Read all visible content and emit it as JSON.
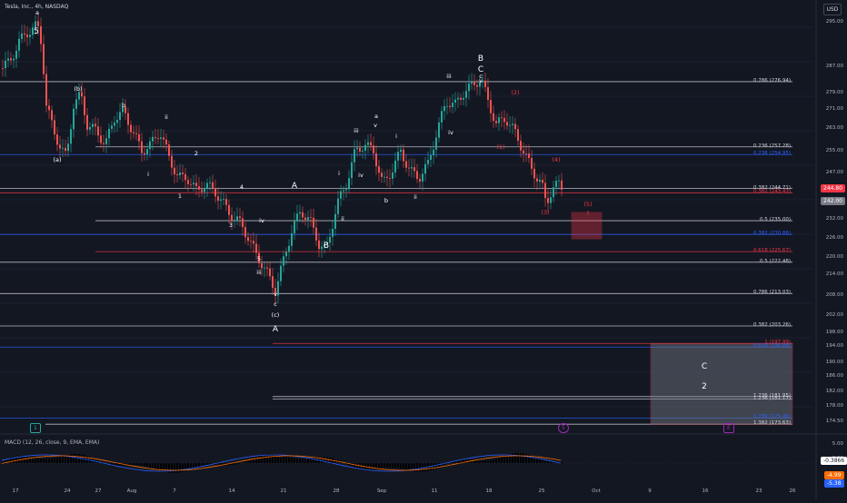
{
  "header": {
    "symbol": "Tesla, Inc., 4h, NASDAQ",
    "currency": "USD"
  },
  "price_axis": [
    "295.00",
    "287.00",
    "279.00",
    "271.00",
    "263.00",
    "255.00",
    "247.00",
    "242.00",
    "237.00",
    "232.00",
    "226.00",
    "220.00",
    "214.00",
    "208.00",
    "202.00",
    "198.00",
    "194.00",
    "190.00",
    "186.00",
    "182.00",
    "178.00",
    "174.50"
  ],
  "date_axis": [
    "17",
    "24",
    "27",
    "Aug",
    "7",
    "14",
    "21",
    "28",
    "Sep",
    "11",
    "18",
    "25",
    "Oct",
    "9",
    "16",
    "23",
    "26"
  ],
  "current_price": "244.80",
  "colors": {
    "up": "#26a69a",
    "down": "#ef5350",
    "fib_white": "#d1d4dc",
    "fib_blue": "#2962ff",
    "fib_red": "#f23645",
    "macd_line": "#2962ff",
    "signal_line": "#ff6d00"
  },
  "fib_levels": [
    {
      "label": "0.786 (276.94)",
      "price": 276.94,
      "color": "white"
    },
    {
      "label": "0.236 (257.28)",
      "price": 257.28,
      "color": "white"
    },
    {
      "label": "0.236 (254.95)",
      "price": 254.95,
      "color": "blue"
    },
    {
      "label": "0.382 (244.71)",
      "price": 244.71,
      "color": "white"
    },
    {
      "label": "0.382 (243.43)",
      "price": 243.43,
      "color": "red"
    },
    {
      "label": "0.5 (235.00)",
      "price": 235.0,
      "color": "white"
    },
    {
      "label": "0.382 (230.86)",
      "price": 230.86,
      "color": "blue"
    },
    {
      "label": "0.618 (225.67)",
      "price": 225.67,
      "color": "red"
    },
    {
      "label": "0.5 (222.48)",
      "price": 222.48,
      "color": "white"
    },
    {
      "label": "0.786 (213.03)",
      "price": 213.03,
      "color": "white"
    },
    {
      "label": "0.382 (203.26)",
      "price": 203.26,
      "color": "white"
    },
    {
      "label": "1 (197.99)",
      "price": 197.99,
      "color": "red"
    },
    {
      "label": "0.618 (196.88)",
      "price": 196.88,
      "color": "blue"
    },
    {
      "label": "1.236 (181.95)",
      "price": 181.95,
      "color": "white"
    },
    {
      "label": "1.236 (181.17)",
      "price": 181.17,
      "color": "white"
    },
    {
      "label": "0.786 (175.46)",
      "price": 175.46,
      "color": "blue"
    },
    {
      "label": "1.382 (173.63)",
      "price": 173.63,
      "color": "white"
    }
  ],
  "wave_labels": [
    {
      "t": "5",
      "color": "white"
    },
    {
      "t": "(a)",
      "color": "white"
    },
    {
      "t": "(b)",
      "color": "white"
    },
    {
      "t": "a",
      "color": "white"
    },
    {
      "t": "b",
      "color": "white"
    },
    {
      "t": "i",
      "color": "white"
    },
    {
      "t": "ii",
      "color": "white"
    },
    {
      "t": "1",
      "color": "white"
    },
    {
      "t": "2",
      "color": "white"
    },
    {
      "t": "3",
      "color": "white"
    },
    {
      "t": "4",
      "color": "white"
    },
    {
      "t": "5",
      "color": "white"
    },
    {
      "t": "iii",
      "color": "white"
    },
    {
      "t": "iv",
      "color": "white"
    },
    {
      "t": "v",
      "color": "white"
    },
    {
      "t": "c",
      "color": "white"
    },
    {
      "t": "(c)",
      "color": "white"
    },
    {
      "t": "A",
      "color": "white"
    },
    {
      "t": "A",
      "color": "white"
    },
    {
      "t": "i",
      "color": "white"
    },
    {
      "t": "ii",
      "color": "white"
    },
    {
      "t": "B",
      "color": "white"
    },
    {
      "t": "iii",
      "color": "white"
    },
    {
      "t": "iv",
      "color": "white"
    },
    {
      "t": "a",
      "color": "white"
    },
    {
      "t": "v",
      "color": "white"
    },
    {
      "t": "b",
      "color": "white"
    },
    {
      "t": "i",
      "color": "white"
    },
    {
      "t": "ii",
      "color": "white"
    },
    {
      "t": "iii",
      "color": "white"
    },
    {
      "t": "iv",
      "color": "white"
    },
    {
      "t": "B",
      "color": "white"
    },
    {
      "t": "C",
      "color": "white"
    },
    {
      "t": "c",
      "color": "white"
    },
    {
      "t": "v",
      "color": "white"
    },
    {
      "t": "(1)",
      "color": "red"
    },
    {
      "t": "(2)",
      "color": "red"
    },
    {
      "t": "(3)",
      "color": "red"
    },
    {
      "t": "(4)",
      "color": "red"
    },
    {
      "t": "(5)",
      "color": "red"
    },
    {
      "t": "?",
      "color": "red"
    },
    {
      "t": "C",
      "color": "white"
    },
    {
      "t": "2",
      "color": "white"
    }
  ],
  "price_badges": [
    "244.80",
    "242.00"
  ],
  "macd": {
    "label": "MACD (12, 26, close, 9, EMA, EMA)",
    "axis": [
      "5.00",
      "0.00"
    ],
    "badges": [
      "-0.3866",
      "-4.99",
      "-5.38"
    ]
  },
  "markers": [
    "1",
    "5",
    "E"
  ]
}
